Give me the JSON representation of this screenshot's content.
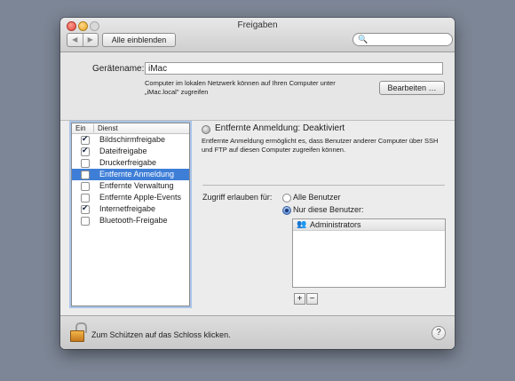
{
  "window": {
    "title": "Freigaben",
    "nav": {
      "back_icon": "◀",
      "forward_icon": "▶"
    },
    "show_all_label": "Alle einblenden",
    "search_icon": "🔍"
  },
  "device": {
    "name_label": "Gerätename:",
    "name_value": "iMac",
    "note": "Computer im lokalen Netzwerk können auf Ihren Computer unter „iMac.local\" zugreifen",
    "edit_label": "Bearbeiten …"
  },
  "services": {
    "header_on": "Ein",
    "header_service": "Dienst",
    "items": [
      {
        "label": "Bildschirmfreigabe",
        "checked": true
      },
      {
        "label": "Dateifreigabe",
        "checked": true
      },
      {
        "label": "Druckerfreigabe",
        "checked": false
      },
      {
        "label": "Entfernte Anmeldung",
        "checked": false,
        "selected": true
      },
      {
        "label": "Entfernte Verwaltung",
        "checked": false
      },
      {
        "label": "Entfernte Apple-Events",
        "checked": false
      },
      {
        "label": "Internetfreigabe",
        "checked": true
      },
      {
        "label": "Bluetooth-Freigabe",
        "checked": false
      }
    ]
  },
  "detail": {
    "status": "Entfernte Anmeldung: Deaktiviert",
    "description": "Entfernte Anmeldung ermöglicht es, dass Benutzer anderer Computer über SSH und FTP auf diesen Computer zugreifen können.",
    "access_label": "Zugriff erlauben für:",
    "option_all": "Alle Benutzer",
    "option_only": "Nur diese Benutzer:",
    "selected_option": "option_only",
    "users": [
      "Administrators"
    ],
    "add_label": "+",
    "remove_label": "−"
  },
  "footer": {
    "lock_text": "Zum Schützen auf das Schloss klicken.",
    "help_label": "?"
  }
}
